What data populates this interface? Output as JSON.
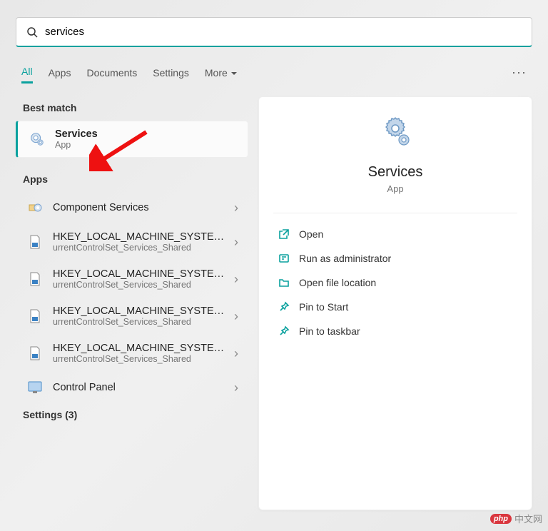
{
  "search": {
    "query": "services"
  },
  "filters": {
    "all": "All",
    "apps": "Apps",
    "documents": "Documents",
    "settings": "Settings",
    "more": "More"
  },
  "left": {
    "best_header": "Best match",
    "best": {
      "title": "Services",
      "sub": "App"
    },
    "apps_header": "Apps",
    "apps": [
      {
        "title": "Component Services"
      },
      {
        "title": "HKEY_LOCAL_MACHINE_SYSTEM_C",
        "title2": "urrentControlSet_Services_Shared"
      },
      {
        "title": "HKEY_LOCAL_MACHINE_SYSTEM_C",
        "title2": "urrentControlSet_Services_Shared"
      },
      {
        "title": "HKEY_LOCAL_MACHINE_SYSTEM_C",
        "title2": "urrentControlSet_Services_Shared"
      },
      {
        "title": "HKEY_LOCAL_MACHINE_SYSTEM_C",
        "title2": "urrentControlSet_Services_Shared"
      },
      {
        "title": "Control Panel"
      }
    ],
    "settings_header": "Settings (3)"
  },
  "detail": {
    "title": "Services",
    "sub": "App",
    "actions": {
      "open": "Open",
      "run_admin": "Run as administrator",
      "open_loc": "Open file location",
      "pin_start": "Pin to Start",
      "pin_taskbar": "Pin to taskbar"
    }
  },
  "watermark": {
    "badge": "php",
    "text": "中文网"
  }
}
